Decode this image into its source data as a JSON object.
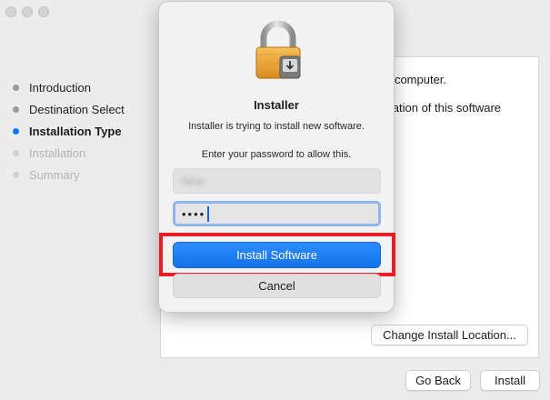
{
  "window": {
    "traffic_lights": [
      "close",
      "minimize",
      "zoom"
    ]
  },
  "steps": [
    {
      "label": "Introduction",
      "state": "done"
    },
    {
      "label": "Destination Select",
      "state": "done"
    },
    {
      "label": "Installation Type",
      "state": "active"
    },
    {
      "label": "Installation",
      "state": "future"
    },
    {
      "label": "Summary",
      "state": "future"
    }
  ],
  "content": {
    "line1": "r computer.",
    "line2": "llation of this software"
  },
  "buttons": {
    "change_location": "Change Install Location...",
    "go_back": "Go Back",
    "install": "Install"
  },
  "dialog": {
    "icon": "lock-icon",
    "title": "Installer",
    "message": "Installer is trying to install new software.",
    "prompt": "Enter your password to allow this.",
    "username_value": "Nha",
    "password_mask": "••••",
    "primary_button": "Install Software",
    "cancel_button": "Cancel"
  },
  "colors": {
    "accent": "#0a7bff",
    "highlight_box": "#ea1c24"
  }
}
